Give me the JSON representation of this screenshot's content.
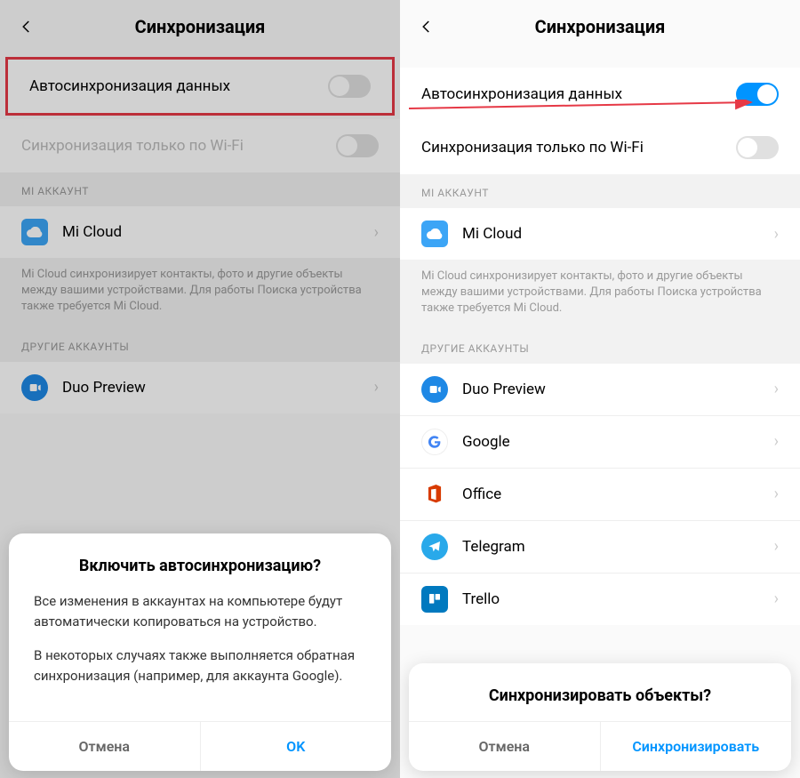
{
  "left": {
    "title": "Синхронизация",
    "autosync_label": "Автосинхронизация данных",
    "wifi_only_label": "Синхронизация только по Wi-Fi",
    "section_mi": "MI АККАУНТ",
    "micloud_label": "Mi Cloud",
    "micloud_desc": "Mi Cloud синхронизирует контакты, фото и другие объекты между вашими устройствами. Для работы Поиска устройства также требуется Mi Cloud.",
    "section_other": "ДРУГИЕ АККАУНТЫ",
    "duo_label": "Duo Preview",
    "dialog": {
      "title": "Включить автосинхронизацию?",
      "p1": "Все изменения в аккаунтах на компьютере будут автоматически копироваться на устройство.",
      "p2": "В некоторых случаях также выполняется обратная синхронизация (например, для аккаунта Google).",
      "cancel": "Отмена",
      "ok": "OK"
    }
  },
  "right": {
    "title": "Синхронизация",
    "autosync_label": "Автосинхронизация данных",
    "wifi_only_label": "Синхронизация только по Wi-Fi",
    "section_mi": "MI АККАУНТ",
    "micloud_label": "Mi Cloud",
    "micloud_desc": "Mi Cloud синхронизирует контакты, фото и другие объекты между вашими устройствами. Для работы Поиска устройства также требуется Mi Cloud.",
    "section_other": "ДРУГИЕ АККАУНТЫ",
    "accounts": {
      "duo": "Duo Preview",
      "google": "Google",
      "office": "Office",
      "telegram": "Telegram",
      "trello": "Trello"
    },
    "dialog": {
      "title": "Синхронизировать объекты?",
      "cancel": "Отмена",
      "ok": "Синхронизировать"
    }
  }
}
